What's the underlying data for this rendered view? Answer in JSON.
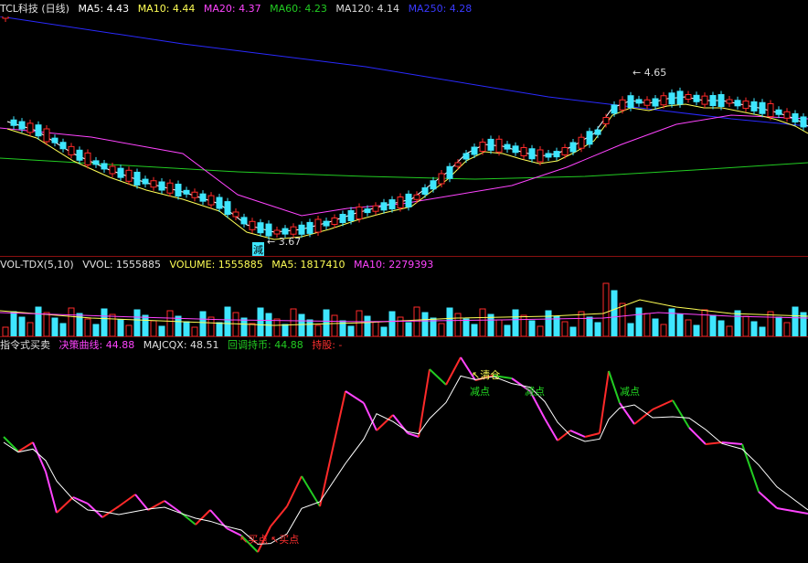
{
  "colors": {
    "up": "#ff2a2a",
    "down": "#3ee6ff",
    "ma5": "#ffffff",
    "ma10": "#ffff55",
    "ma20": "#ff44ff",
    "ma60": "#22cc22",
    "ma120": "#dddddd",
    "ma250": "#2a2aff",
    "vol_ma10": "#ff44ff",
    "divider": "#8a1010"
  },
  "price_panel": {
    "title": "TCL科技 (日线)",
    "ma5": "MA5: 4.43",
    "ma10": "MA10: 4.44",
    "ma20": "MA20: 4.37",
    "ma60": "MA60: 4.23",
    "ma120": "MA120: 4.14",
    "ma250": "MA250: 4.28",
    "high_label": "4.65",
    "low_label": "3.67",
    "marker_label": "減"
  },
  "volume_panel": {
    "title": "VOL-TDX(5,10)",
    "vvol": "VVOL: 1555885",
    "volume": "VOLUME: 1555885",
    "ma5": "MA5: 1817410",
    "ma10": "MA10: 2279393"
  },
  "indicator_panel": {
    "title": "指令式买卖",
    "decision_line": "决策曲线: 44.88",
    "majcqx": "MAJCQX: 48.51",
    "pullback_hold": "回调持币: 44.88",
    "holding": "持股: -",
    "signal_clear": "清仓",
    "signal_reduce": "减点",
    "signal_buy": "买点"
  }
}
